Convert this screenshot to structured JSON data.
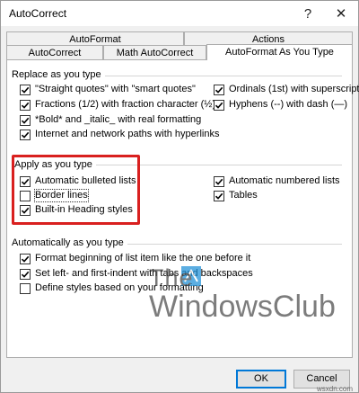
{
  "window": {
    "title": "AutoCorrect",
    "help_glyph": "?",
    "close_glyph": "✕"
  },
  "tabs_row1": [
    {
      "label": "AutoFormat"
    },
    {
      "label": "Actions"
    }
  ],
  "tabs_row2": [
    {
      "label": "AutoCorrect"
    },
    {
      "label": "Math AutoCorrect"
    },
    {
      "label": "AutoFormat As You Type",
      "active": true
    }
  ],
  "replace_group": {
    "title": "Replace as you type",
    "left": [
      {
        "label": "\"Straight quotes\" with \"smart quotes\"",
        "checked": true
      },
      {
        "label": "Fractions (1/2) with fraction character (½)",
        "checked": true
      },
      {
        "label": "*Bold* and _italic_ with real formatting",
        "checked": true
      },
      {
        "label": "Internet and network paths with hyperlinks",
        "checked": true
      }
    ],
    "right": [
      {
        "label": "Ordinals (1st) with superscript",
        "checked": true
      },
      {
        "label": "Hyphens (--) with dash (—)",
        "checked": true
      }
    ]
  },
  "apply_group": {
    "title": "Apply as you type",
    "left": [
      {
        "label": "Automatic bulleted lists",
        "checked": true
      },
      {
        "label": "Border lines",
        "checked": false
      },
      {
        "label": "Built-in Heading styles",
        "checked": true
      }
    ],
    "right": [
      {
        "label": "Automatic numbered lists",
        "checked": true
      },
      {
        "label": "Tables",
        "checked": true
      }
    ]
  },
  "auto_group": {
    "title": "Automatically as you type",
    "items": [
      {
        "label": "Format beginning of list item like the one before it",
        "checked": true
      },
      {
        "label": "Set left- and first-indent with tabs and backspaces",
        "checked": true
      },
      {
        "label": "Define styles based on your formatting",
        "checked": false
      }
    ]
  },
  "buttons": {
    "ok": "OK",
    "cancel": "Cancel"
  },
  "watermark": {
    "line1": "The",
    "line2": "WindowsClub"
  },
  "site_tag": "wsxdn.com",
  "colors": {
    "highlight": "#d9201f",
    "accent": "#0078d7"
  }
}
